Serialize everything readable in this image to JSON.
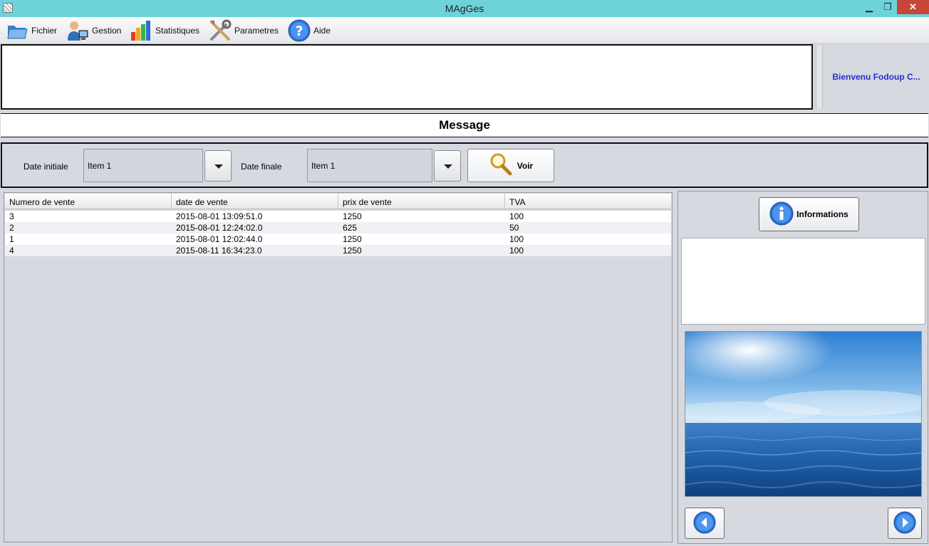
{
  "window": {
    "title": "MAgGes",
    "minimize": "▁",
    "maximize": "❐",
    "close": "✕"
  },
  "menu": [
    {
      "label": "Fichier",
      "icon": "folder-icon"
    },
    {
      "label": "Gestion",
      "icon": "user-computer-icon"
    },
    {
      "label": "Statistiques",
      "icon": "bar-chart-icon"
    },
    {
      "label": "Parametres",
      "icon": "tools-icon"
    },
    {
      "label": "Aide",
      "icon": "help-icon"
    }
  ],
  "welcome": "Bienvenu Fodoup C...",
  "message": "Message",
  "filters": {
    "date_initiale_label": "Date initiale",
    "date_initiale_value": "Item 1",
    "date_finale_label": "Date finale",
    "date_finale_value": "Item 1",
    "voir_label": "Voir"
  },
  "table": {
    "columns": [
      "Numero de vente",
      "date de vente",
      "prix de vente",
      "TVA"
    ],
    "rows": [
      [
        "3",
        "2015-08-01 13:09:51.0",
        "1250",
        "100"
      ],
      [
        "2",
        "2015-08-01 12:24:02.0",
        "625",
        "50"
      ],
      [
        "1",
        "2015-08-01 12:02:44.0",
        "1250",
        "100"
      ],
      [
        "4",
        "2015-08-11 16:34:23.0",
        "1250",
        "100"
      ]
    ]
  },
  "side": {
    "informations_label": "Informations"
  },
  "colors": {
    "titlebar": "#6dd3db",
    "welcome_text": "#2a2ad8",
    "close": "#c7463a"
  }
}
